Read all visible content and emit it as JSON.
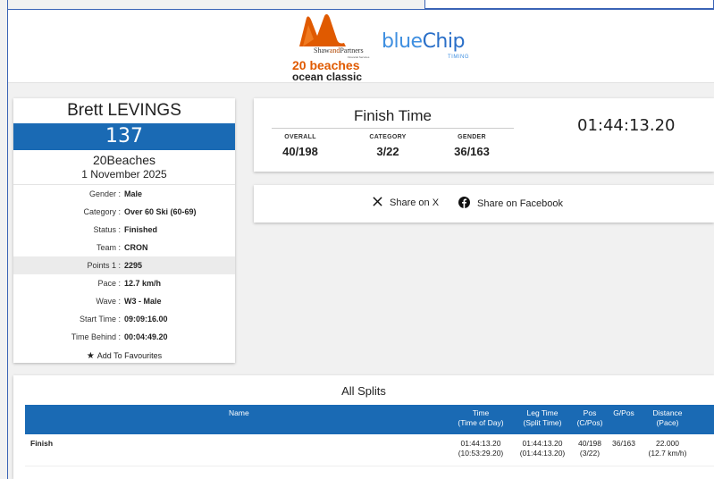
{
  "header": {
    "sponsor_logo": {
      "name_prefix": "Shaw",
      "name_and": "and",
      "name_suffix": "Partners",
      "sub": "Financial Services"
    },
    "event_logo_line1": "20 beaches",
    "event_logo_line2": "ocean classic",
    "timing_logo": {
      "blue": "blue",
      "chip": "Chip",
      "sub": "TIMING"
    }
  },
  "athlete": {
    "name": "Brett LEVINGS",
    "bib": "137",
    "event": "20Beaches",
    "date": "1 November 2025",
    "details": [
      {
        "key": "Gender :",
        "value": "Male"
      },
      {
        "key": "Category :",
        "value": "Over 60 Ski (60-69)"
      },
      {
        "key": "Status :",
        "value": "Finished"
      },
      {
        "key": "Team :",
        "value": "CRON"
      },
      {
        "key": "Points 1 :",
        "value": "2295"
      },
      {
        "key": "Pace :",
        "value": "12.7 km/h"
      },
      {
        "key": "Wave :",
        "value": "W3 - Male"
      },
      {
        "key": "Start Time :",
        "value": "09:09:16.00"
      },
      {
        "key": "Time Behind :",
        "value": "00:04:49.20"
      }
    ],
    "favourites_label": "Add To Favourites"
  },
  "finish": {
    "title": "Finish Time",
    "overall_label": "OVERALL",
    "overall_value": "40/198",
    "category_label": "CATEGORY",
    "category_value": "3/22",
    "gender_label": "GENDER",
    "gender_value": "36/163",
    "time": "01:44:13.20"
  },
  "share": {
    "x_label": "Share on X",
    "facebook_label": "Share on Facebook"
  },
  "splits": {
    "title": "All Splits",
    "headers": {
      "name": "Name",
      "time_1": "Time",
      "time_2": "(Time of Day)",
      "leg_1": "Leg Time",
      "leg_2": "(Split Time)",
      "pos_1": "Pos",
      "pos_2": "(C/Pos)",
      "gpos": "G/Pos",
      "dist_1": "Distance",
      "dist_2": "(Pace)"
    },
    "rows": [
      {
        "name": "Finish",
        "time_1": "01:44:13.20",
        "time_2": "(10:53:29.20)",
        "leg_1": "01:44:13.20",
        "leg_2": "(01:44:13.20)",
        "pos_1": "40/198",
        "pos_2": "(3/22)",
        "gpos": "36/163",
        "dist_1": "22.000",
        "dist_2": "(12.7 km/h)"
      }
    ]
  },
  "colors": {
    "primary_blue": "#1a6ab4",
    "logo_orange": "#e05a00",
    "bluechip": "#3f8fe0"
  }
}
